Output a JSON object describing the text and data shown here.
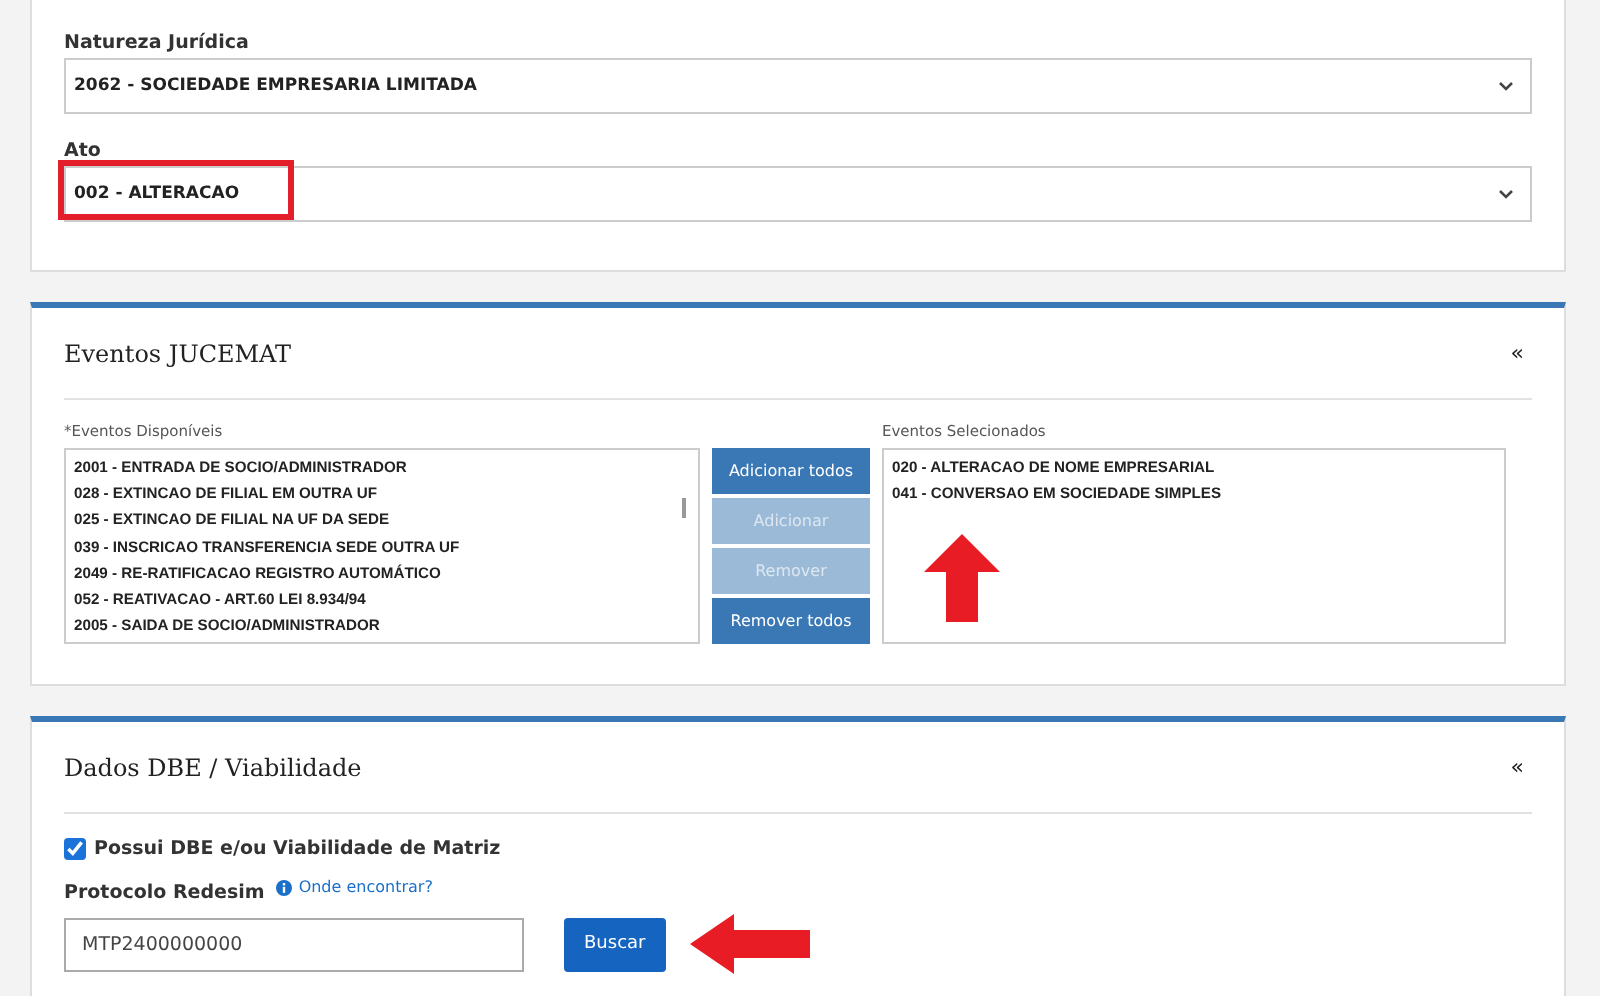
{
  "general": {
    "fields": [
      {
        "label": "Natureza Jurídica",
        "value": "2062 - SOCIEDADE EMPRESARIA LIMITADA",
        "highlighted": false
      },
      {
        "label": "Ato",
        "value": "002 - ALTERACAO",
        "highlighted": true
      }
    ]
  },
  "eventos": {
    "title": "Eventos JUCEMAT",
    "collapse": "«",
    "available_label": "*Eventos Disponíveis",
    "available": [
      "2001 - ENTRADA DE SOCIO/ADMINISTRADOR",
      "028 - EXTINCAO DE FILIAL EM OUTRA UF",
      "025 - EXTINCAO DE FILIAL NA UF DA SEDE",
      "039 - INSCRICAO TRANSFERENCIA SEDE OUTRA UF",
      "2049 - RE-RATIFICACAO REGISTRO AUTOMÁTICO",
      "052 - REATIVACAO - ART.60 LEI 8.934/94",
      "2005 - SAIDA DE SOCIO/ADMINISTRADOR"
    ],
    "buttons": [
      {
        "label": "Adicionar todos",
        "disabled": false
      },
      {
        "label": "Adicionar",
        "disabled": true
      },
      {
        "label": "Remover",
        "disabled": true
      },
      {
        "label": "Remover todos",
        "disabled": false
      }
    ],
    "selected_label": "Eventos Selecionados",
    "selected": [
      "020 - ALTERACAO DE NOME EMPRESARIAL",
      "041 - CONVERSAO EM SOCIEDADE SIMPLES"
    ]
  },
  "dbe": {
    "title": "Dados DBE / Viabilidade",
    "collapse": "«",
    "checkbox": {
      "label": "Possui DBE e/ou Viabilidade de Matriz",
      "checked": true
    },
    "protocolo_label": "Protocolo Redesim",
    "help_link": "Onde encontrar?",
    "protocolo_value": "MTP2400000000",
    "search_button": "Buscar"
  }
}
